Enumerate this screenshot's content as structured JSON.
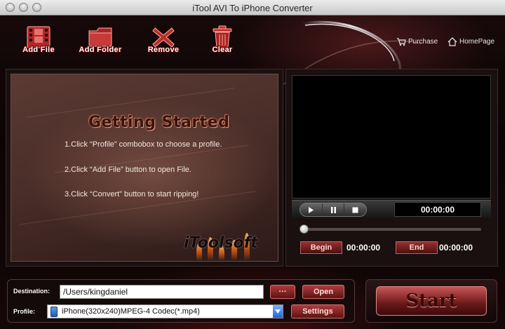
{
  "window": {
    "title": "iTool AVI To iPhone Converter"
  },
  "toolbar": {
    "add_file": "Add File",
    "add_folder": "Add Folder",
    "remove": "Remove",
    "clear": "Clear"
  },
  "toplinks": {
    "purchase": "Purchase",
    "homepage": "HomePage"
  },
  "getting_started": {
    "title": "Getting  Started",
    "steps": [
      "1.Click “Profile” combobox to choose a profile.",
      "2.Click “Add File” button to open File.",
      "3.Click “Convert” button to start ripping!"
    ],
    "brand": "iToolsoft"
  },
  "player": {
    "current_time": "00:00:00",
    "begin_label": "Begin",
    "begin_time": "00:00:00",
    "end_label": "End",
    "end_time": "00:00:00",
    "slider_position": 0
  },
  "output": {
    "destination_label": "Destination:",
    "destination_value": "/Users/kingdaniel",
    "browse_label": "···",
    "open_label": "Open",
    "profile_label": "Profile:",
    "profile_value": "iPhone(320x240)MPEG-4 Codec(*.mp4)",
    "settings_label": "Settings"
  },
  "start_label": "Start"
}
